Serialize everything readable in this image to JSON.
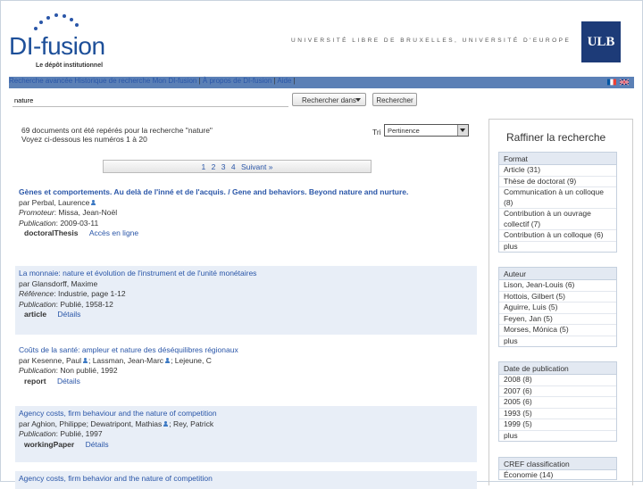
{
  "header": {
    "logo_text": "DI-fusion",
    "logo_tagline": "Le dépôt institutionnel",
    "university_line": "UNIVERSITÉ LIBRE DE BRUXELLES, UNIVERSITÉ D'EUROPE",
    "ulb_logo": "ULB"
  },
  "nav": {
    "advanced_search": "Recherche avancée",
    "history": "Historique de recherche",
    "my_difusion": "Mon DI-fusion",
    "about": "À propos de DI-fusion",
    "help": "Aide",
    "separator": "|",
    "flags": [
      "fr-flag-icon",
      "uk-flag-icon"
    ]
  },
  "search": {
    "query": "nature",
    "scope_label": "Rechercher dans",
    "button": "Rechercher"
  },
  "results": {
    "count_line": "69 documents ont été repérés pour la recherche \"nature\"",
    "range_line": "Voyez ci-dessous les numéros 1 à 20",
    "sort_label": "Tri",
    "sort_value": "Pertinence",
    "pages": [
      "1",
      "2",
      "3",
      "4"
    ],
    "next": "Suivant »",
    "items": [
      {
        "title": "Gènes et comportements. Au delà de l'inné et de l'acquis. / Gene and behaviors. Beyond nature and nurture.",
        "author_label": "par",
        "authors": "Perbal, Laurence",
        "promoter_label": "Promoteur",
        "promoter": "Missa, Jean-Noël",
        "pub_label": "Publication",
        "publication": "2009-03-11",
        "type": "doctoralThesis",
        "action": "Accès en ligne"
      },
      {
        "title": "La monnaie: nature et évolution de l'instrument et de l'unité monétaires",
        "author_label": "par",
        "authors": "Glansdorff, Maxime",
        "ref_label": "Référence",
        "reference": "Industrie, page 1-12",
        "pub_label": "Publication",
        "publication": "Publié, 1958-12",
        "type": "article",
        "action": "Détails"
      },
      {
        "title": "Coûts de la santé: ampleur et nature des déséquilibres régionaux",
        "author_label": "par",
        "authors_a": "Kesenne, Paul",
        "authors_b": "; Lassman, Jean-Marc",
        "authors_c": "; Lejeune, C",
        "pub_label": "Publication",
        "publication": "Non publié, 1992",
        "type": "report",
        "action": "Détails"
      },
      {
        "title": "Agency costs, firm behaviour and the nature of competition",
        "author_label": "par",
        "authors_a": "Aghion, Philippe",
        "authors_b": "; Dewatripont, Mathias",
        "authors_c": "; Rey, Patrick",
        "pub_label": "Publication",
        "publication": "Publié, 1997",
        "type": "workingPaper",
        "action": "Détails"
      },
      {
        "title": "Agency costs, firm behavior and the nature of competition"
      }
    ]
  },
  "refine": {
    "title": "Raffiner la recherche",
    "facets": [
      {
        "head": "Format",
        "rows": [
          "Article (31)",
          "Thèse de doctorat (9)",
          "Communication à un colloque (8)",
          "Contribution à un ouvrage collectif (7)",
          "Contribution à un colloque (6)",
          "plus"
        ]
      },
      {
        "head": "Auteur",
        "rows": [
          "Lison, Jean-Louis (6)",
          "Hottois, Gilbert (5)",
          "Aguirre, Luis (5)",
          "Feyen, Jan (5)",
          "Morses, Mónica (5)",
          "plus"
        ]
      },
      {
        "head": "Date de publication",
        "rows": [
          "2008 (8)",
          "2007 (6)",
          "2005 (6)",
          "1993 (5)",
          "1999 (5)",
          "plus"
        ]
      },
      {
        "head": "CREF classification",
        "rows": [
          "Économie (14)"
        ]
      }
    ]
  }
}
